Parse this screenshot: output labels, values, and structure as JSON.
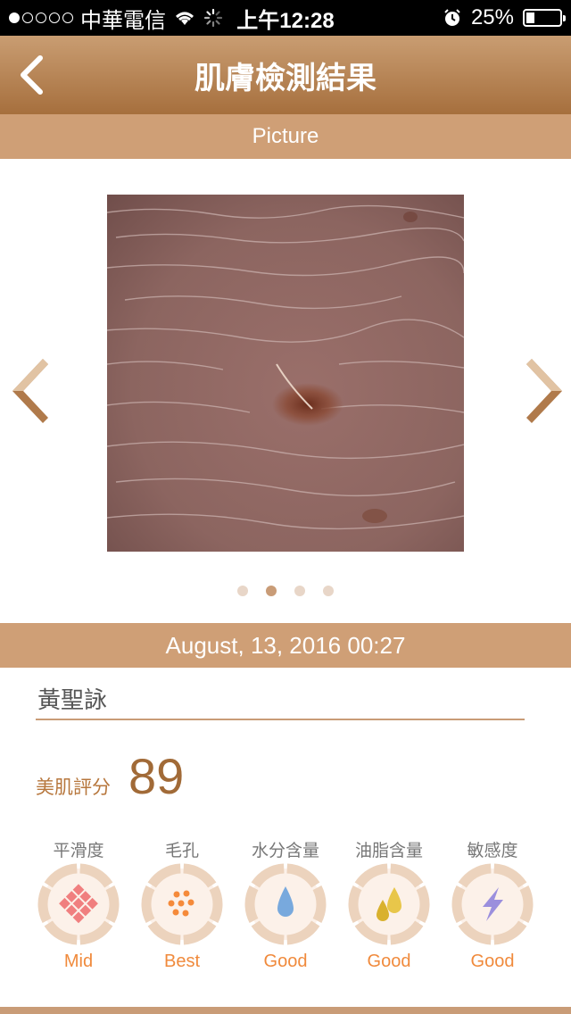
{
  "status_bar": {
    "carrier": "中華電信",
    "time": "上午12:28",
    "battery_percent": "25%",
    "battery_level": 0.25,
    "signal_bars": 1
  },
  "nav": {
    "title": "肌膚檢測結果",
    "back_icon": "chevron-left-icon"
  },
  "picture": {
    "header": "Picture",
    "prev_icon": "chevron-left-icon",
    "next_icon": "chevron-right-icon",
    "page_count": 4,
    "active_page": 2
  },
  "record": {
    "date": "August, 13, 2016 00:27",
    "name": "黃聖詠"
  },
  "score": {
    "label": "美肌評分",
    "value": "89"
  },
  "metrics": [
    {
      "label": "平滑度",
      "value": "Mid",
      "icon": "diamond-grid-icon",
      "icon_color": "#f07f7f"
    },
    {
      "label": "毛孔",
      "value": "Best",
      "icon": "dots-cluster-icon",
      "icon_color": "#f58a3a"
    },
    {
      "label": "水分含量",
      "value": "Good",
      "icon": "water-drop-icon",
      "icon_color": "#78a9dd"
    },
    {
      "label": "油脂含量",
      "value": "Good",
      "icon": "oil-drops-icon",
      "icon_color": "#e5c03a"
    },
    {
      "label": "敏感度",
      "value": "Good",
      "icon": "lightning-icon",
      "icon_color": "#9b8fdd"
    }
  ],
  "colors": {
    "brand": "#c99c77",
    "nav_top": "#c99d72",
    "nav_bottom": "#a66f3d",
    "score": "#a16a37",
    "metric_value": "#f08a3c",
    "ring": "#ecd3bd"
  }
}
